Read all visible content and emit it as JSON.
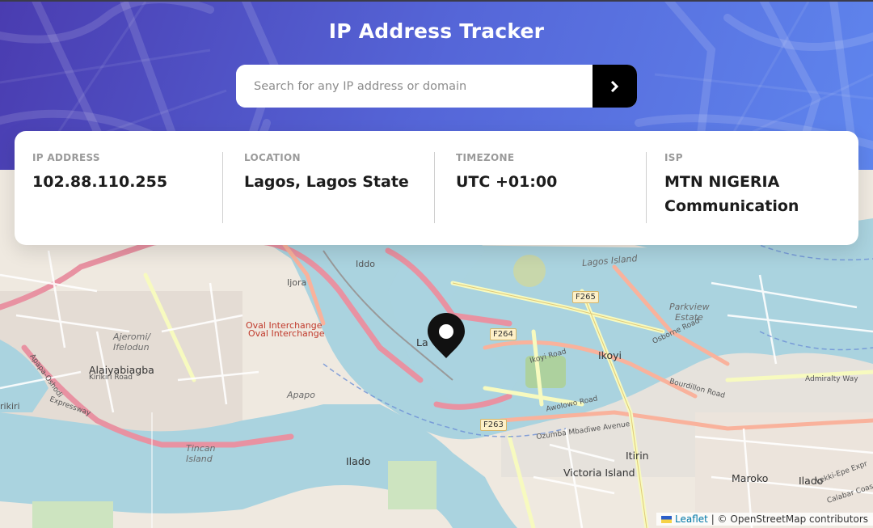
{
  "app": {
    "title": "IP Address Tracker"
  },
  "search": {
    "placeholder": "Search for any IP address or domain",
    "value": "",
    "submit_icon": "chevron-right-icon"
  },
  "info": [
    {
      "label": "IP Address",
      "value": "102.88.110.255"
    },
    {
      "label": "Location",
      "value": "Lagos, Lagos State"
    },
    {
      "label": "Timezone",
      "value": "UTC +01:00"
    },
    {
      "label": "ISP",
      "value": "MTN NIGERIA Communication"
    }
  ],
  "map": {
    "marker_icon": "location-pin-icon",
    "labels": {
      "iddo": "Iddo",
      "ijora": "Ijora",
      "oval1": "Oval Interchange",
      "oval2": "Oval Interchange",
      "ajeromi1": "Ajeromi/",
      "ajeromi2": "Ifelodun",
      "alaiyabiagba": "Alaiyabiagba",
      "kirikiri_road": "Kirikiri Road",
      "kirikiri": "rikiri",
      "apapo": "Apapo",
      "tincan1": "Tincan",
      "tincan2": "Island",
      "ilado1": "Ilado",
      "ikoyi": "Ikoyi",
      "parkview1": "Parkview",
      "parkview2": "Estate",
      "itirin": "Itirin",
      "victoria_island": "Victoria Island",
      "maroko": "Maroko",
      "ilado2": "Ilado",
      "lagos_island": "Lagos Island",
      "la": "La",
      "ikoyi_road": "Ikoyi Road",
      "awolowo_road": "Awolowo Road",
      "osborne_road": "Osborne Road",
      "bourdillon_road": "Bourdillon Road",
      "admiralty_way": "Admiralty Way",
      "ozumba": "Ozumba Mbadiwe Avenue",
      "expressway": "Expressway",
      "lekki_epe": "Lekki-Epe Expr",
      "calabar": "Calabar Coas",
      "apapa_oshodi": "Apapa-Oshodi"
    },
    "shields": {
      "f265": "F265",
      "f264": "F264",
      "f263": "F263"
    },
    "attribution": {
      "leaflet": "Leaflet",
      "osm": "| © OpenStreetMap contributors"
    }
  },
  "colors": {
    "header_start": "#4a3cb0",
    "header_end": "#5f86ee",
    "button": "#000000",
    "water": "#aad3df"
  }
}
